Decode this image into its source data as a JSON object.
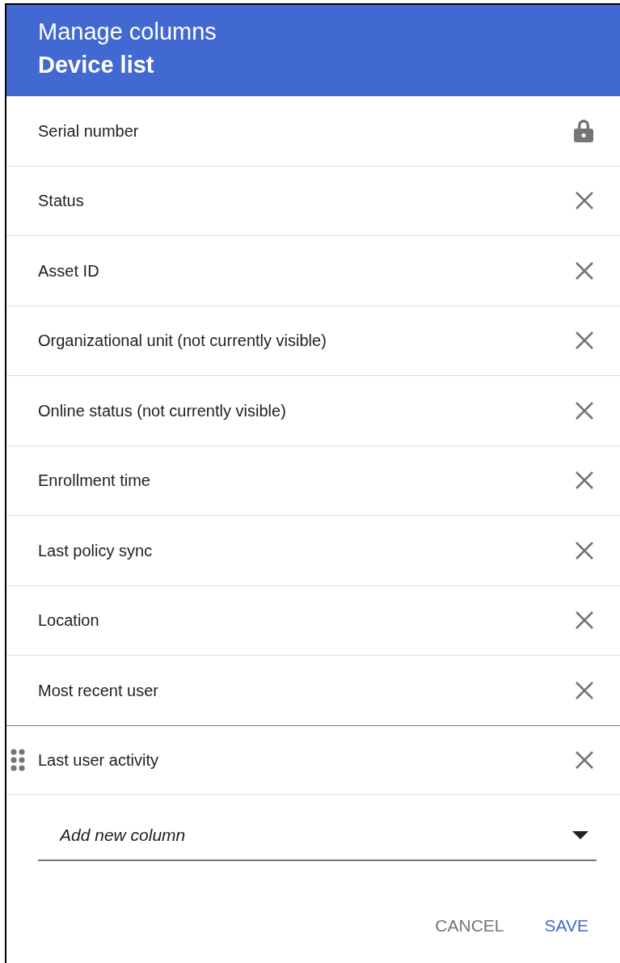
{
  "dialog": {
    "title": "Manage columns",
    "subtitle": "Device list"
  },
  "columns": [
    {
      "label": "Serial number",
      "kind": "locked",
      "hovered": false
    },
    {
      "label": "Status",
      "kind": "removable",
      "hovered": false
    },
    {
      "label": "Asset ID",
      "kind": "removable",
      "hovered": false
    },
    {
      "label": "Organizational unit (not currently visible)",
      "kind": "removable",
      "hovered": false
    },
    {
      "label": "Online status (not currently visible)",
      "kind": "removable",
      "hovered": false
    },
    {
      "label": "Enrollment time",
      "kind": "removable",
      "hovered": false
    },
    {
      "label": "Last policy sync",
      "kind": "removable",
      "hovered": false
    },
    {
      "label": "Location",
      "kind": "removable",
      "hovered": false
    },
    {
      "label": "Most recent user",
      "kind": "removable",
      "hovered": false
    },
    {
      "label": "Last user activity",
      "kind": "removable",
      "hovered": true
    }
  ],
  "add_column": {
    "placeholder": "Add new column"
  },
  "buttons": [
    {
      "label": "CANCEL",
      "kind": "secondary"
    },
    {
      "label": "SAVE",
      "kind": "primary"
    }
  ]
}
